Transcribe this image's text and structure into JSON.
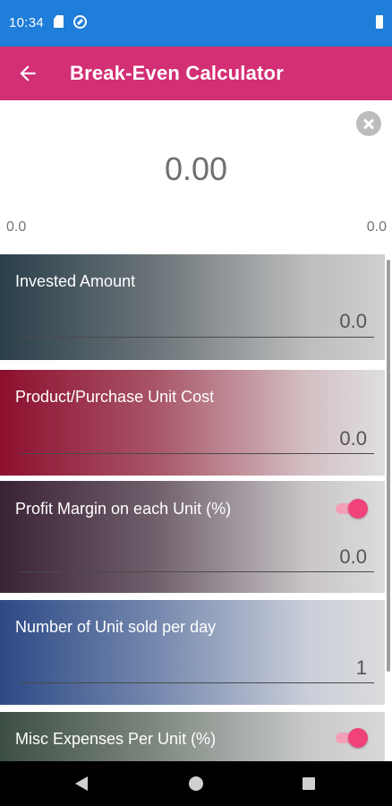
{
  "status_bar": {
    "time": "10:34"
  },
  "app_bar": {
    "title": "Break-Even Calculator"
  },
  "display": {
    "result": "0.00",
    "left_value": "0.0",
    "right_value": "0.0"
  },
  "fields": [
    {
      "label": "Invested Amount",
      "value": "0.0"
    },
    {
      "label": "Product/Purchase Unit Cost",
      "value": "0.0"
    },
    {
      "label": "Profit Margin on each Unit (%)",
      "value": "0.0",
      "toggle_on": true
    },
    {
      "label": "Number of Unit sold per day",
      "value": "1"
    },
    {
      "label": "Misc Expenses Per Unit (%)",
      "toggle_on": true
    }
  ],
  "colors": {
    "status_bar": "#1f7ed9",
    "app_bar": "#d32f74",
    "toggle_accent": "#f0437a"
  }
}
